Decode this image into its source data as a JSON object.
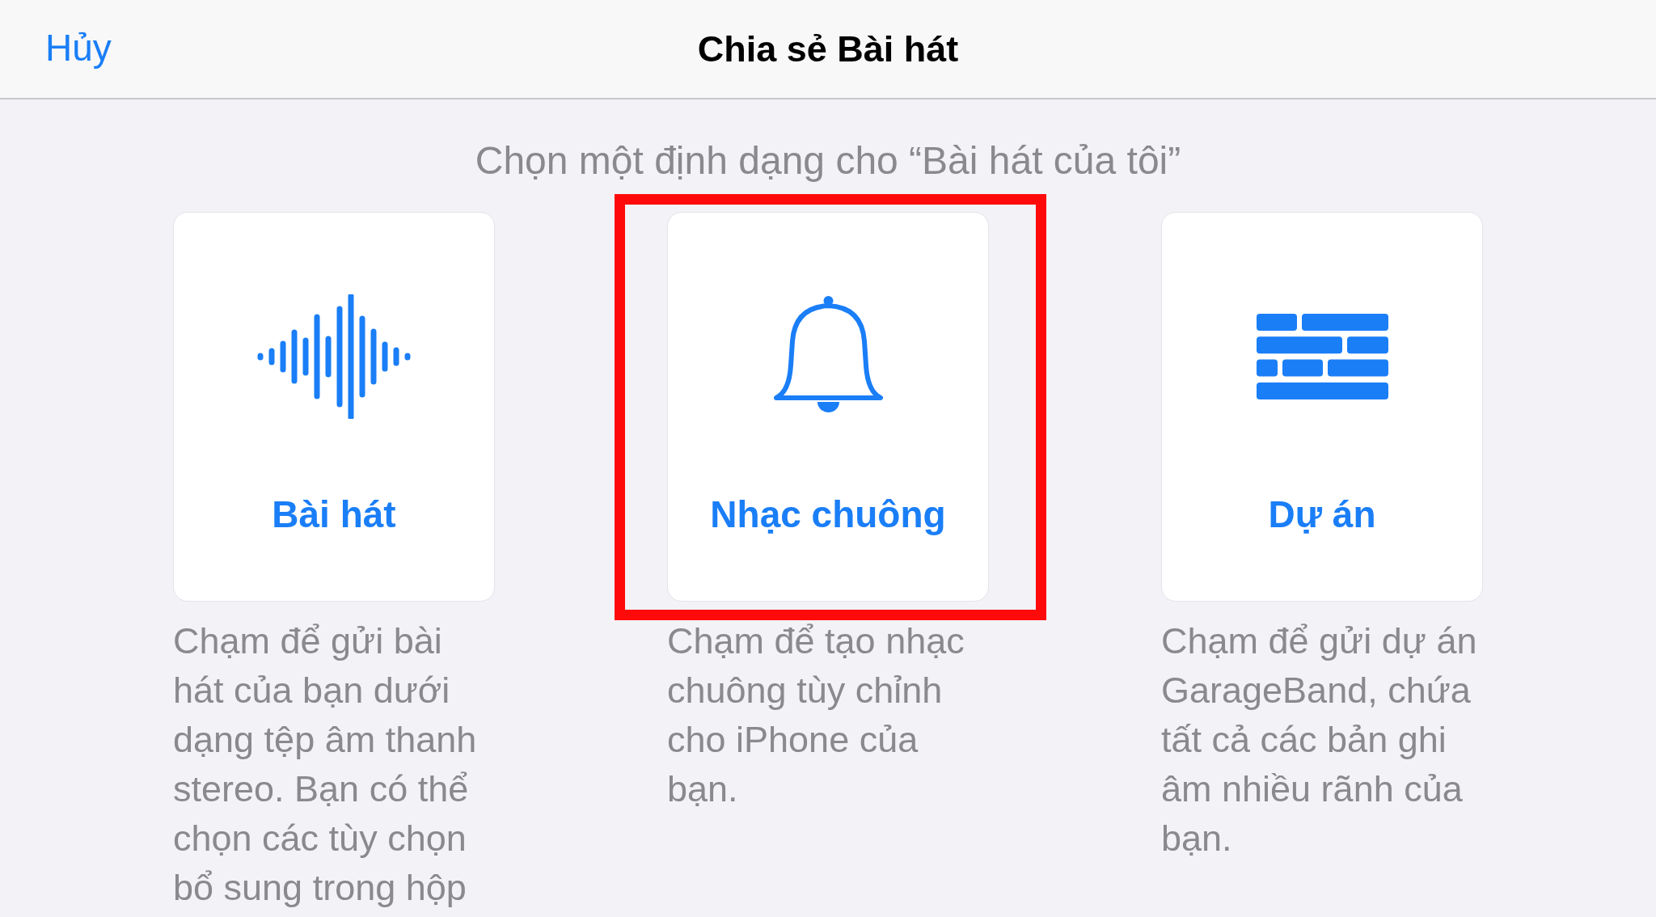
{
  "header": {
    "cancel": "Hủy",
    "title": "Chia sẻ Bài hát"
  },
  "prompt": "Chọn một định dạng cho “Bài hát của tôi”",
  "formats": [
    {
      "kind": "song",
      "label": "Bài hát",
      "highlighted": false,
      "description_lines": [
        "Chạm để gửi bài",
        "hát của bạn dưới",
        "dạng tệp âm thanh",
        "stereo. Bạn có thể",
        "chọn các tùy chọn",
        "bổ sung trong hộp"
      ]
    },
    {
      "kind": "ringtone",
      "label": "Nhạc chuông",
      "highlighted": true,
      "description_lines": [
        "Chạm để tạo nhạc",
        "chuông tùy chỉnh",
        "cho iPhone của",
        "bạn."
      ]
    },
    {
      "kind": "project",
      "label": "Dự án",
      "highlighted": false,
      "description_lines": [
        "Chạm để gửi dự án",
        "GarageBand, chứa",
        "tất cả các bản ghi",
        "âm nhiều rãnh của",
        "bạn."
      ]
    }
  ]
}
